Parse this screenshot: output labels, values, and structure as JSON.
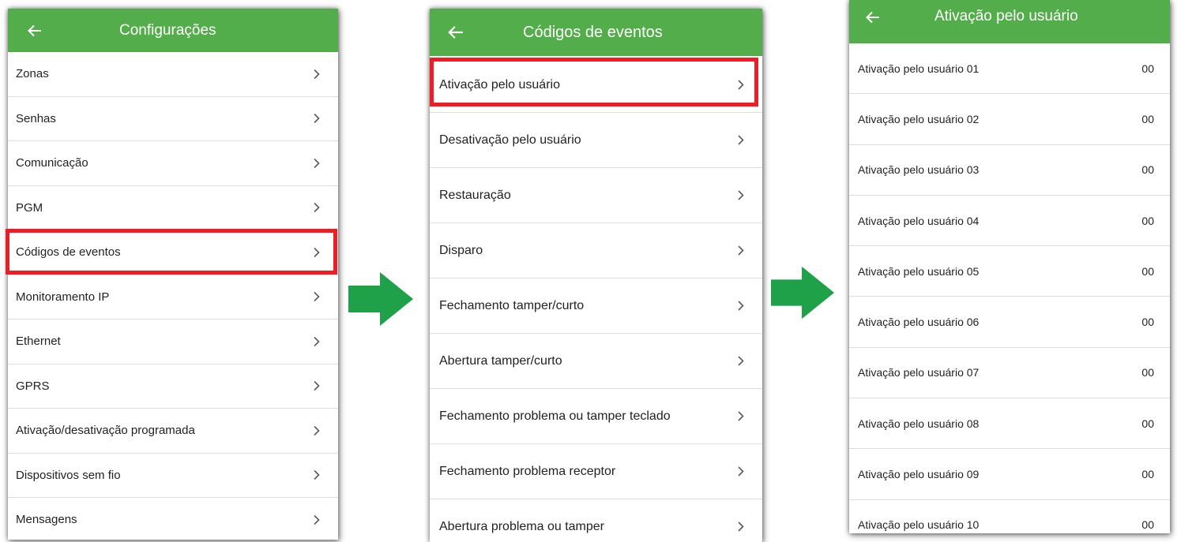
{
  "colors": {
    "appbar": "#53ad4b",
    "highlight": "#ee1c24",
    "arrow": "#1fa14a",
    "chevron": "#5a5a5a"
  },
  "icons": {
    "back": "arrow-left-icon",
    "chevron": "chevron-right-icon",
    "flow": "right-arrow-icon"
  },
  "panel1": {
    "title": "Configurações",
    "items": [
      {
        "label": "Zonas"
      },
      {
        "label": "Senhas"
      },
      {
        "label": "Comunicação"
      },
      {
        "label": "PGM"
      },
      {
        "label": "Códigos de eventos"
      },
      {
        "label": "Monitoramento IP"
      },
      {
        "label": "Ethernet"
      },
      {
        "label": "GPRS"
      },
      {
        "label": "Ativação/desativação programada"
      },
      {
        "label": "Dispositivos sem fio"
      },
      {
        "label": "Mensagens"
      }
    ]
  },
  "panel2": {
    "title": "Códigos de eventos",
    "items": [
      {
        "label": "Ativação pelo usuário"
      },
      {
        "label": "Desativação pelo usuário"
      },
      {
        "label": "Restauração"
      },
      {
        "label": "Disparo"
      },
      {
        "label": "Fechamento tamper/curto"
      },
      {
        "label": "Abertura tamper/curto"
      },
      {
        "label": "Fechamento problema ou tamper teclado"
      },
      {
        "label": "Fechamento problema receptor"
      },
      {
        "label": "Abertura problema ou tamper"
      }
    ]
  },
  "panel3": {
    "title": "Ativação pelo usuário",
    "items": [
      {
        "label": "Ativação pelo usuário 01",
        "value": "00"
      },
      {
        "label": "Ativação pelo usuário 02",
        "value": "00"
      },
      {
        "label": "Ativação pelo usuário 03",
        "value": "00"
      },
      {
        "label": "Ativação pelo usuário 04",
        "value": "00"
      },
      {
        "label": "Ativação pelo usuário 05",
        "value": "00"
      },
      {
        "label": "Ativação pelo usuário 06",
        "value": "00"
      },
      {
        "label": "Ativação pelo usuário 07",
        "value": "00"
      },
      {
        "label": "Ativação pelo usuário 08",
        "value": "00"
      },
      {
        "label": "Ativação pelo usuário 09",
        "value": "00"
      },
      {
        "label": "Ativação pelo usuário 10",
        "value": "00"
      }
    ]
  }
}
